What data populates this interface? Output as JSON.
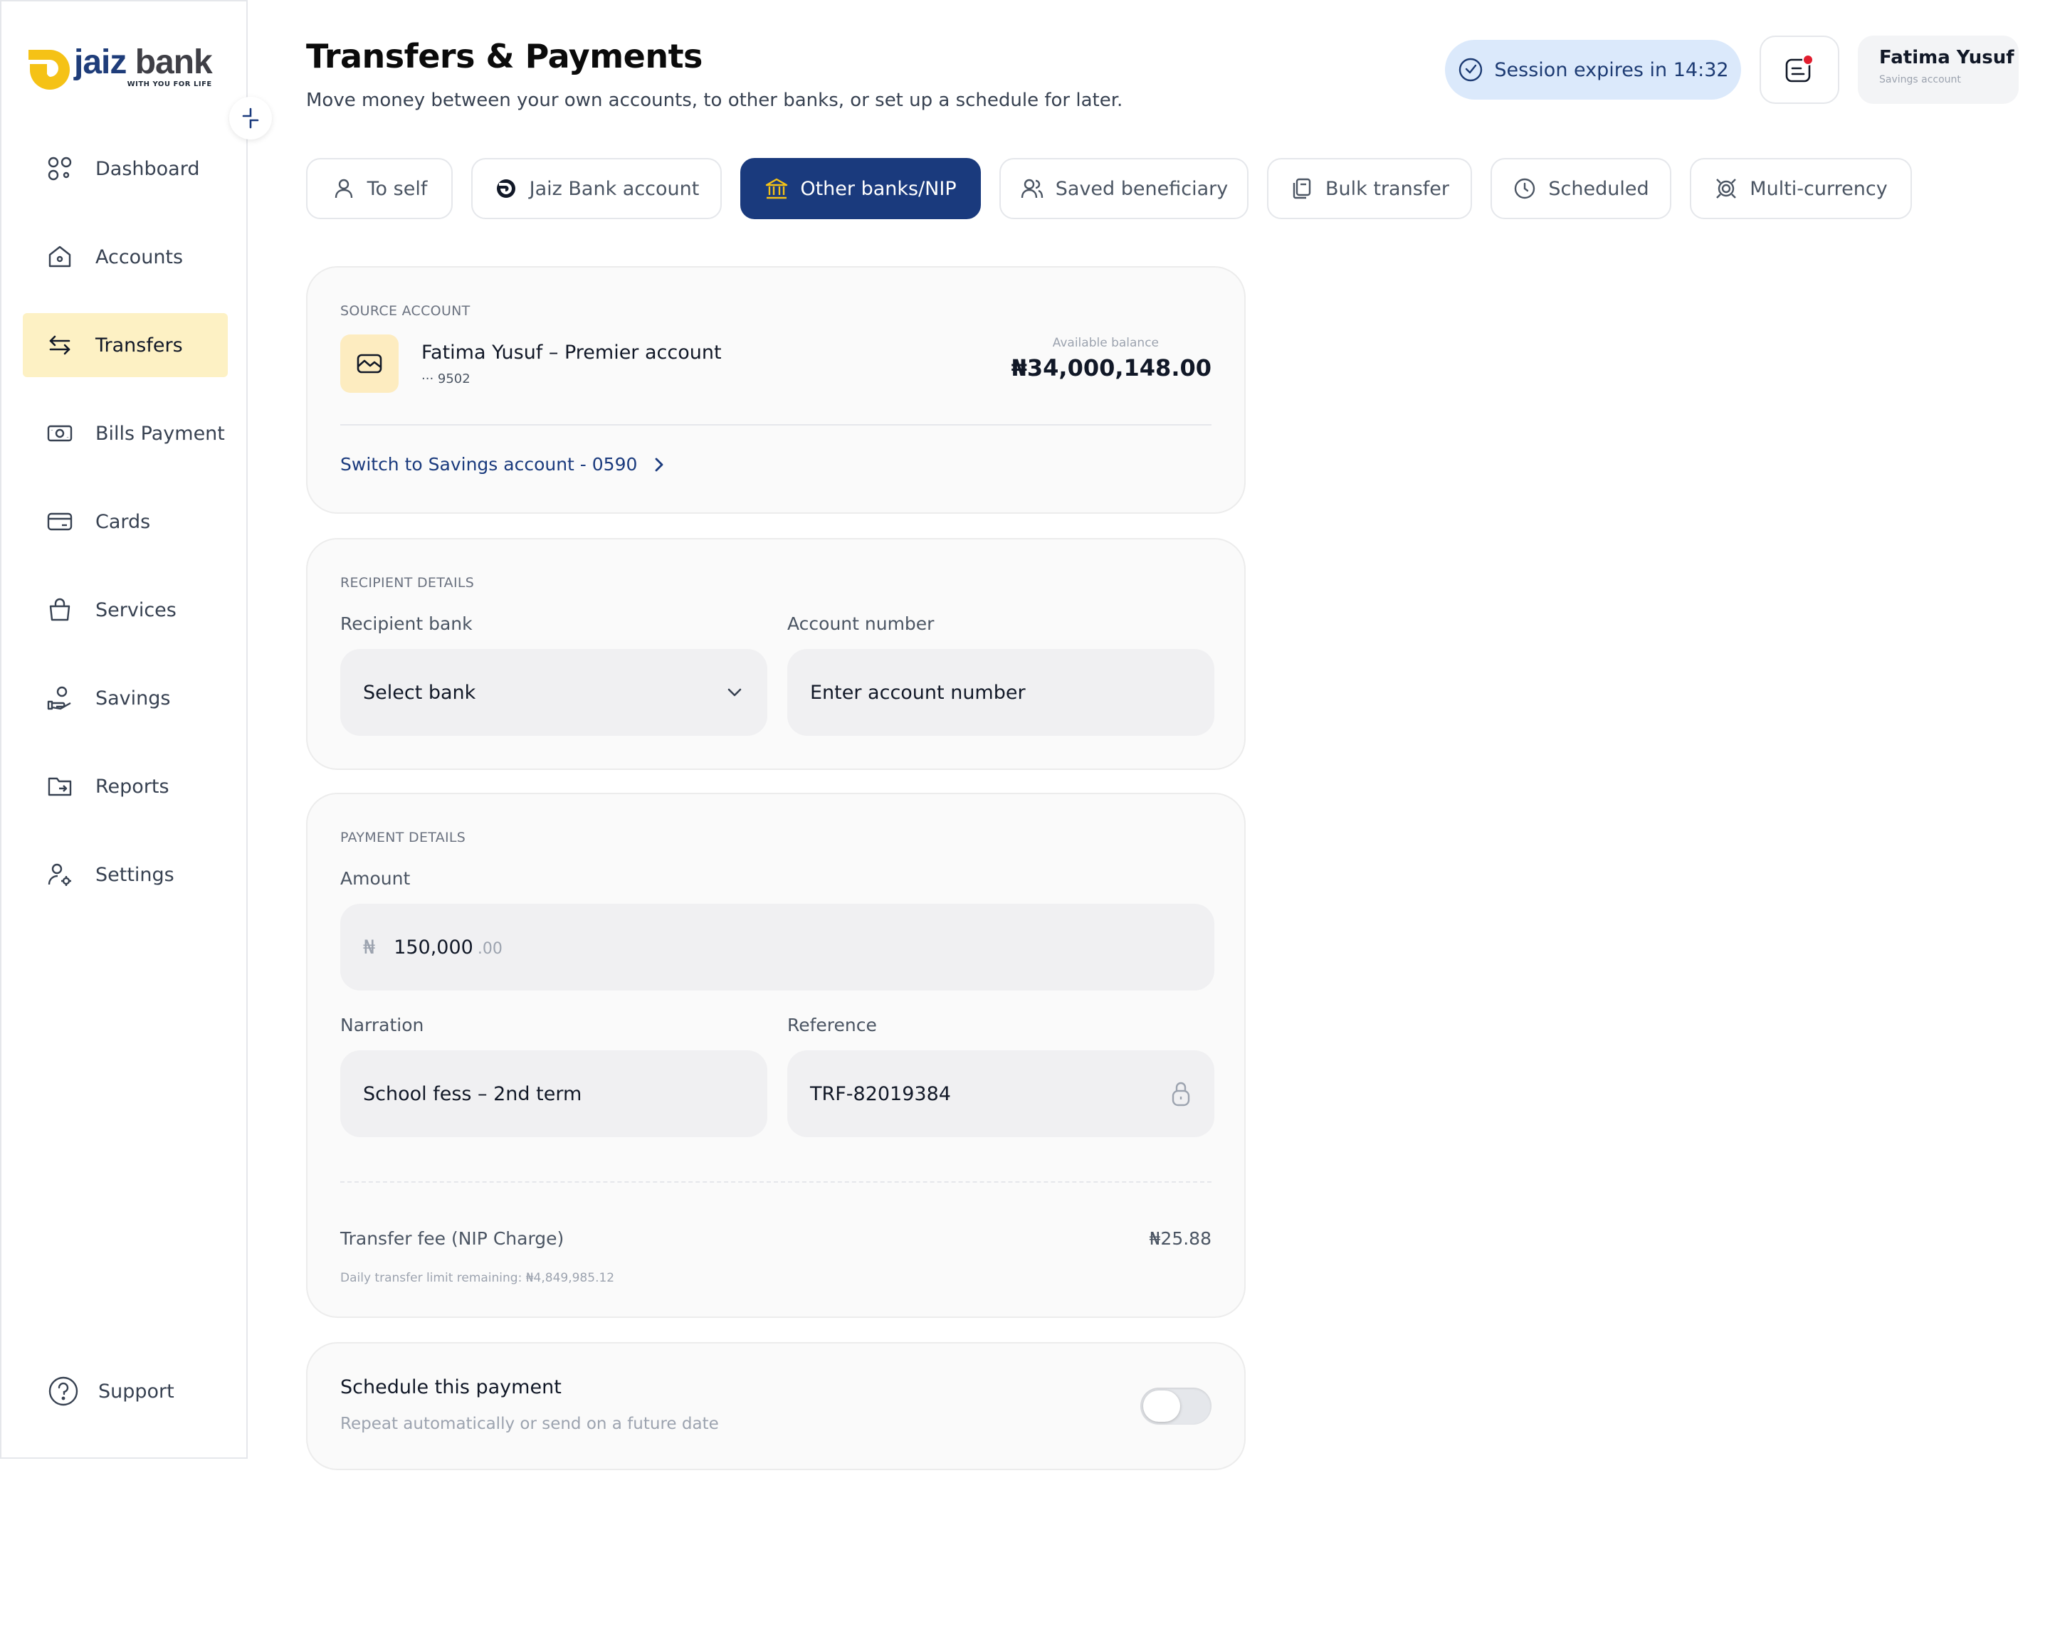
{
  "brand": {
    "name_part1": "jaiz",
    "name_part2": "bank",
    "tagline": "WITH YOU FOR LIFE",
    "accent": "#f5c216",
    "primary": "#1a3a7d"
  },
  "sidebar": {
    "items": [
      {
        "label": "Dashboard",
        "icon": "dashboard-icon",
        "active": false
      },
      {
        "label": "Accounts",
        "icon": "home-icon",
        "active": false
      },
      {
        "label": "Transfers",
        "icon": "arrows-swap-icon",
        "active": true
      },
      {
        "label": "Bills Payment",
        "icon": "banknote-icon",
        "active": false
      },
      {
        "label": "Cards",
        "icon": "card-icon",
        "active": false
      },
      {
        "label": "Services",
        "icon": "bag-icon",
        "active": false
      },
      {
        "label": "Savings",
        "icon": "hand-coin-icon",
        "active": false
      },
      {
        "label": "Reports",
        "icon": "folder-icon",
        "active": false
      },
      {
        "label": "Settings",
        "icon": "user-gear-icon",
        "active": false
      }
    ],
    "support_label": "Support"
  },
  "header": {
    "title": "Transfers & Payments",
    "subtitle": "Move money between your own accounts, to other banks, or set up a schedule for later.",
    "session": "Session expires in 14:32",
    "user_name": "Fatima Yusuf",
    "user_sub": "Savings account"
  },
  "tabs": [
    {
      "label": "To self",
      "icon": "user-icon",
      "active": false
    },
    {
      "label": "Jaiz Bank account",
      "icon": "jaiz-icon",
      "active": false
    },
    {
      "label": "Other banks/NIP",
      "icon": "bank-icon",
      "active": true
    },
    {
      "label": "Saved beneficiary",
      "icon": "users-icon",
      "active": false
    },
    {
      "label": "Bulk transfer",
      "icon": "stack-icon",
      "active": false
    },
    {
      "label": "Scheduled",
      "icon": "clock-icon",
      "active": false
    },
    {
      "label": "Multi-currency",
      "icon": "currency-icon",
      "active": false
    }
  ],
  "source": {
    "section": "SOURCE ACCOUNT",
    "name": "Fatima Yusuf – Premier account",
    "masked": "··· 9502",
    "balance_label": "Available balance",
    "balance": "₦34,000,148.00",
    "switch_label": "Switch to Savings account - 0590"
  },
  "recipient": {
    "section": "RECIPIENT DETAILS",
    "bank_label": "Recipient bank",
    "bank_value": "Select bank",
    "account_label": "Account number",
    "account_placeholder": "Enter account number"
  },
  "payment": {
    "section": "PAYMENT DETAILS",
    "amount_label": "Amount",
    "currency_symbol": "₦",
    "amount": "150,000",
    "amount_decimals": ".00",
    "narration_label": "Narration",
    "narration_value": "School fess – 2nd term",
    "reference_label": "Reference",
    "reference_value": "TRF-82019384",
    "fee_label": "Transfer fee (NIP Charge)",
    "fee_value": "₦25.88",
    "limit_text": "Daily transfer limit remaining: ₦4,849,985.12"
  },
  "schedule": {
    "title": "Schedule this payment",
    "subtitle": "Repeat automatically or send on a future date",
    "enabled": false
  }
}
